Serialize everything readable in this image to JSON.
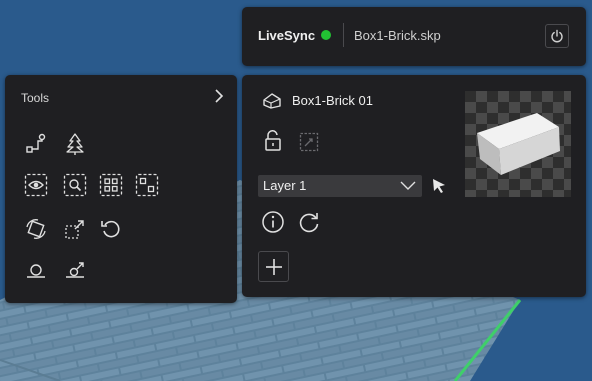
{
  "livesync": {
    "title": "LiveSync",
    "status_color": "#22c233",
    "filename": "Box1-Brick.skp",
    "power_icon": "power-icon"
  },
  "tools": {
    "title": "Tools",
    "expand_icon": "chevron-right-icon",
    "items": [
      {
        "icon": "connect-points-icon"
      },
      {
        "icon": "tree-icon"
      },
      {
        "icon": "eye-frame-icon"
      },
      {
        "icon": "search-frame-icon"
      },
      {
        "icon": "grid-frame-icon"
      },
      {
        "icon": "selection-frame-icon"
      },
      {
        "icon": "rotate-box-icon"
      },
      {
        "icon": "expand-box-icon"
      },
      {
        "icon": "undo-icon"
      },
      {
        "icon": "pin-ground-icon"
      },
      {
        "icon": "arrow-ground-icon"
      }
    ]
  },
  "model": {
    "name": "Box1-Brick 01",
    "model_icon": "cube-icon",
    "lock_icon": "unlock-icon",
    "snap_icon": "snap-icon",
    "layer": {
      "selected": "Layer 1",
      "icon": "chevron-down-icon"
    },
    "pick_icon": "cursor-pick-icon",
    "info_icon": "info-icon",
    "refresh_icon": "redo-icon",
    "add_icon": "plus-icon"
  },
  "colors": {
    "panel_bg": "#1f1f22",
    "scene_blue": "#2a5a8c",
    "accent_green": "#22c233"
  }
}
